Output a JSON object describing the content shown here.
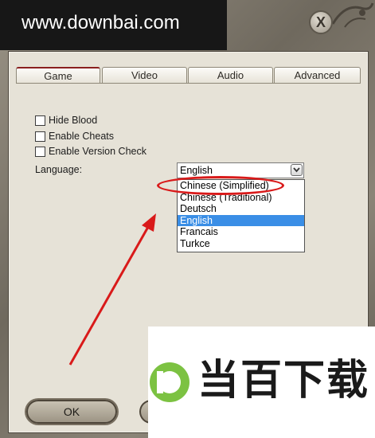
{
  "watermark": {
    "text": "www.downbai.com"
  },
  "window": {
    "close_label": "X"
  },
  "tabs": [
    {
      "label": "Game",
      "active": true
    },
    {
      "label": "Video",
      "active": false
    },
    {
      "label": "Audio",
      "active": false
    },
    {
      "label": "Advanced",
      "active": false
    }
  ],
  "options": {
    "hide_blood": {
      "label": "Hide Blood",
      "checked": false
    },
    "enable_cheats": {
      "label": "Enable Cheats",
      "checked": false
    },
    "enable_version_check": {
      "label": "Enable Version Check",
      "checked": false
    }
  },
  "language": {
    "label": "Language:",
    "selected": "English",
    "options": [
      "Chinese (Simplified)",
      "Chinese (Traditional)",
      "Deutsch",
      "English",
      "Francais",
      "Turkce"
    ],
    "highlighted_index": 3
  },
  "buttons": {
    "ok_label": "OK"
  },
  "logo": {
    "text": "当百下载",
    "letter": "D"
  },
  "colors": {
    "annotation_red": "#d91a1a",
    "selection_blue": "#3a8ee6",
    "logo_green": "#7cc242"
  }
}
